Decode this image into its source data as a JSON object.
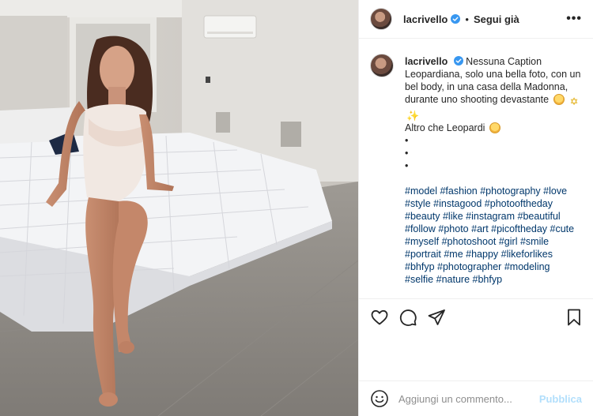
{
  "post": {
    "username": "lacrivello",
    "separator": "•",
    "follow_label": "Segui già",
    "more_label": "•••"
  },
  "caption": {
    "username": "lacrivello",
    "line1": "Nessuna Caption",
    "line2": "Leopardiana, solo una bella foto, con un",
    "line3": "bel body, in una casa della Madonna,",
    "line4": "durante uno shooting devastante",
    "line5": "Altro che Leopardi",
    "bullets": [
      "•",
      "•",
      "•"
    ],
    "hashtag_lines": [
      [
        "#model",
        "#fashion",
        "#photography",
        "#love"
      ],
      [
        "#style",
        "#instagood",
        "#photooftheday"
      ],
      [
        "#beauty",
        "#like",
        "#instagram",
        "#beautiful"
      ],
      [
        "#follow",
        "#photo",
        "#art",
        "#picoftheday",
        "#cute"
      ],
      [
        "#myself",
        "#photoshoot",
        "#girl",
        "#smile"
      ],
      [
        "#portrait",
        "#me",
        "#happy",
        "#likeforlikes"
      ],
      [
        "#bhfyp",
        "#photographer",
        "#modeling"
      ],
      [
        "#selfie",
        "#nature",
        "#bhfyp"
      ]
    ]
  },
  "icons": {
    "like": "heart-icon",
    "comment": "comment-icon",
    "share": "paper-plane-icon",
    "save": "bookmark-icon",
    "emoji": "smiley-icon",
    "verified": "verified-badge-icon"
  },
  "comment_box": {
    "placeholder": "Aggiungi un commento...",
    "post_label": "Pubblica"
  },
  "colors": {
    "text": "#262626",
    "hashtag": "#00376b",
    "verified": "#3897f0",
    "post_disabled": "#b2dffc",
    "border": "#efefef"
  }
}
